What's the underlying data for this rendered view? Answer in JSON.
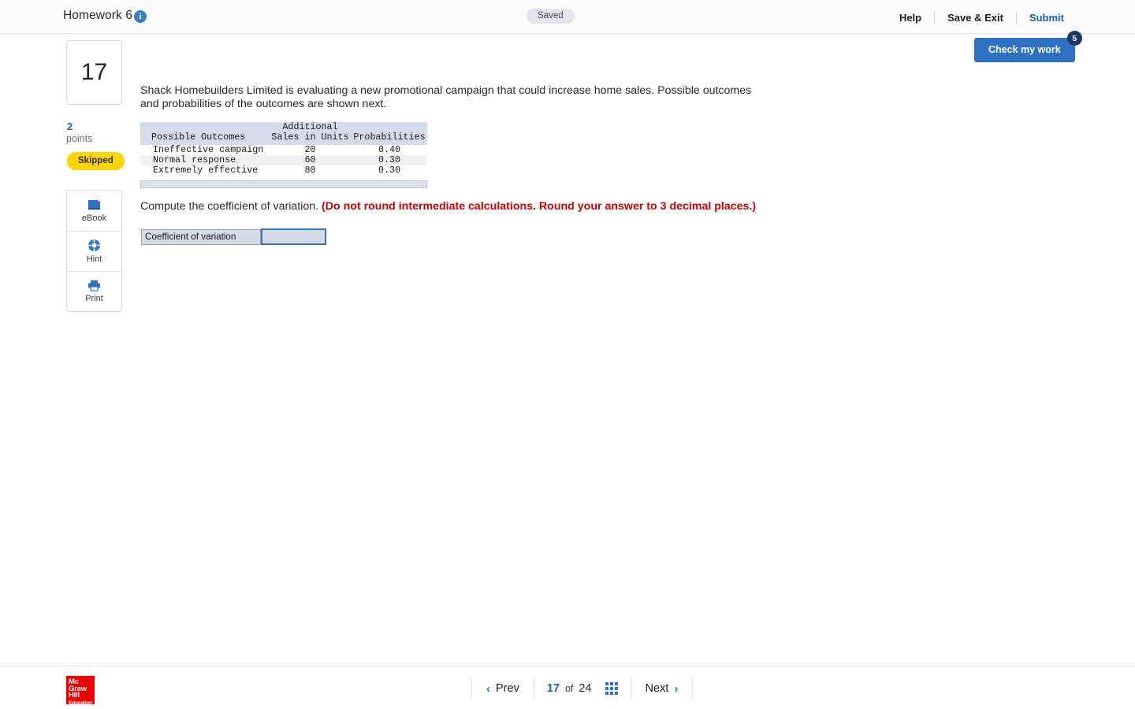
{
  "header": {
    "title": "Homework 6",
    "info_icon": "info-icon",
    "status_badge": "Saved",
    "links": [
      {
        "label": "Help",
        "name": "help-link"
      },
      {
        "label": "Save & Exit",
        "name": "save-exit-link"
      },
      {
        "label": "Submit",
        "name": "submit-link"
      }
    ]
  },
  "check_my_work": {
    "label": "Check my work",
    "badge_count": "5"
  },
  "question_rail": {
    "number": "17",
    "points_value": "2",
    "points_label": "points",
    "status": "Skipped",
    "tools": [
      {
        "label": "eBook",
        "icon": "book-icon"
      },
      {
        "label": "Hint",
        "icon": "life-ring-icon"
      },
      {
        "label": "Print",
        "icon": "printer-icon"
      }
    ]
  },
  "question": {
    "stem": "Shack Homebuilders Limited is evaluating a new promotional campaign that could increase home sales. Possible outcomes and probabilities of the outcomes are shown next.",
    "prompt_plain": "Compute the coefficient of variation. ",
    "prompt_emphasis": "(Do not round intermediate calculations. Round your answer to 3 decimal places.)",
    "answer_label": "Coefficient of variation",
    "answer_value": "",
    "answer_placeholder": ""
  },
  "table": {
    "header_top": [
      "",
      "Additional",
      ""
    ],
    "header_bottom": [
      "Possible Outcomes",
      "Sales in Units",
      "Probabilities"
    ],
    "rows": [
      [
        "Ineffective campaign",
        "20",
        "0.40"
      ],
      [
        "Normal response",
        "60",
        "0.30"
      ],
      [
        "Extremely effective",
        "80",
        "0.30"
      ]
    ]
  },
  "footer": {
    "logo_line1": "Mc",
    "logo_line2": "Graw",
    "logo_line3": "Hill",
    "logo_line4": "Education",
    "prev_label": "Prev",
    "next_label": "Next",
    "current_page": "17",
    "of_label": "of",
    "total_pages": "24",
    "grid_icon": "grid-icon"
  },
  "colors": {
    "accent_blue": "#2f72c4",
    "link_blue": "#1b5fa8",
    "badge_navy": "#173a63",
    "skipped_yellow": "#fdd502",
    "emphasis_red": "#d10000",
    "logo_red": "#ec0000",
    "table_header_bg": "#d5dbe8",
    "input_fill": "#d4dae6"
  }
}
